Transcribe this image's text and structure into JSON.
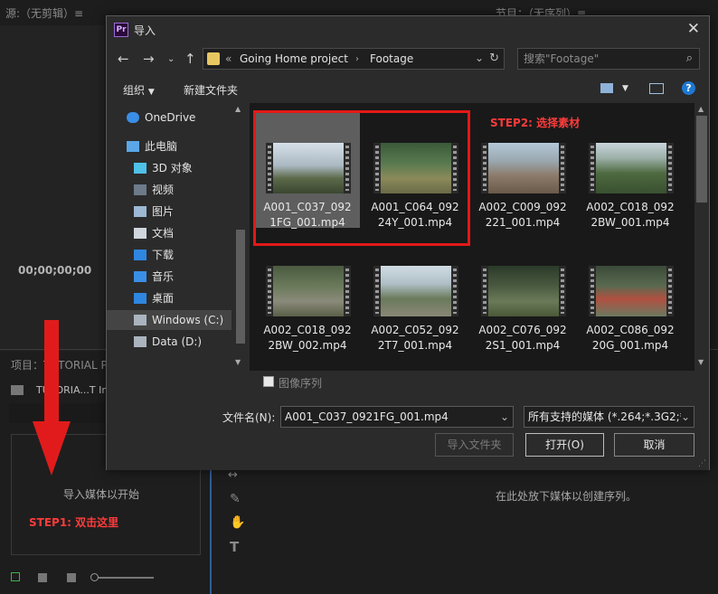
{
  "background": {
    "source_panel_title": "源:（无剪辑）≡",
    "program_panel_title": "节目：（无序列）≡",
    "timecode": "00;00;00;00",
    "project_panel_title": "项目：TUTORIAL PRO",
    "project_file": "TUTORIA...T Imp",
    "import_hint": "导入媒体以开始",
    "sequence_hint": "在此处放下媒体以创建序列。",
    "step1": "STEP1: 双击这里"
  },
  "dialog": {
    "title": "导入",
    "breadcrumb_prefix": "«",
    "breadcrumb": [
      "Going Home project",
      "Footage"
    ],
    "search_placeholder": "搜索\"Footage\"",
    "organize": "组织",
    "new_folder": "新建文件夹",
    "nav_items": [
      {
        "label": "OneDrive",
        "icon": "cloud-icon"
      },
      {
        "label": "此电脑",
        "icon": "computer-icon"
      },
      {
        "label": "3D 对象",
        "icon": "cube-icon"
      },
      {
        "label": "视频",
        "icon": "video-icon"
      },
      {
        "label": "图片",
        "icon": "picture-icon"
      },
      {
        "label": "文档",
        "icon": "document-icon"
      },
      {
        "label": "下载",
        "icon": "download-icon"
      },
      {
        "label": "音乐",
        "icon": "music-icon"
      },
      {
        "label": "桌面",
        "icon": "desktop-icon"
      },
      {
        "label": "Windows (C:)",
        "icon": "drive-icon"
      },
      {
        "label": "Data (D:)",
        "icon": "drive-icon"
      }
    ],
    "files": [
      {
        "line1": "A001_C037_092",
        "line2": "1FG_001.mp4"
      },
      {
        "line1": "A001_C064_092",
        "line2": "24Y_001.mp4"
      },
      {
        "line1": "A002_C009_092",
        "line2": "221_001.mp4"
      },
      {
        "line1": "A002_C018_092",
        "line2": "2BW_001.mp4"
      },
      {
        "line1": "A002_C018_092",
        "line2": "2BW_002.mp4"
      },
      {
        "line1": "A002_C052_092",
        "line2": "2T7_001.mp4"
      },
      {
        "line1": "A002_C076_092",
        "line2": "2S1_001.mp4"
      },
      {
        "line1": "A002_C086_092",
        "line2": "20G_001.mp4"
      }
    ],
    "step2": "STEP2: 选择素材",
    "image_sequence": "图像序列",
    "filename_label": "文件名(N):",
    "filename_value": "A001_C037_0921FG_001.mp4",
    "filetype_value": "所有支持的媒体 (*.264;*.3G2;*",
    "import_folder": "导入文件夹",
    "open": "打开(O)",
    "cancel": "取消"
  }
}
